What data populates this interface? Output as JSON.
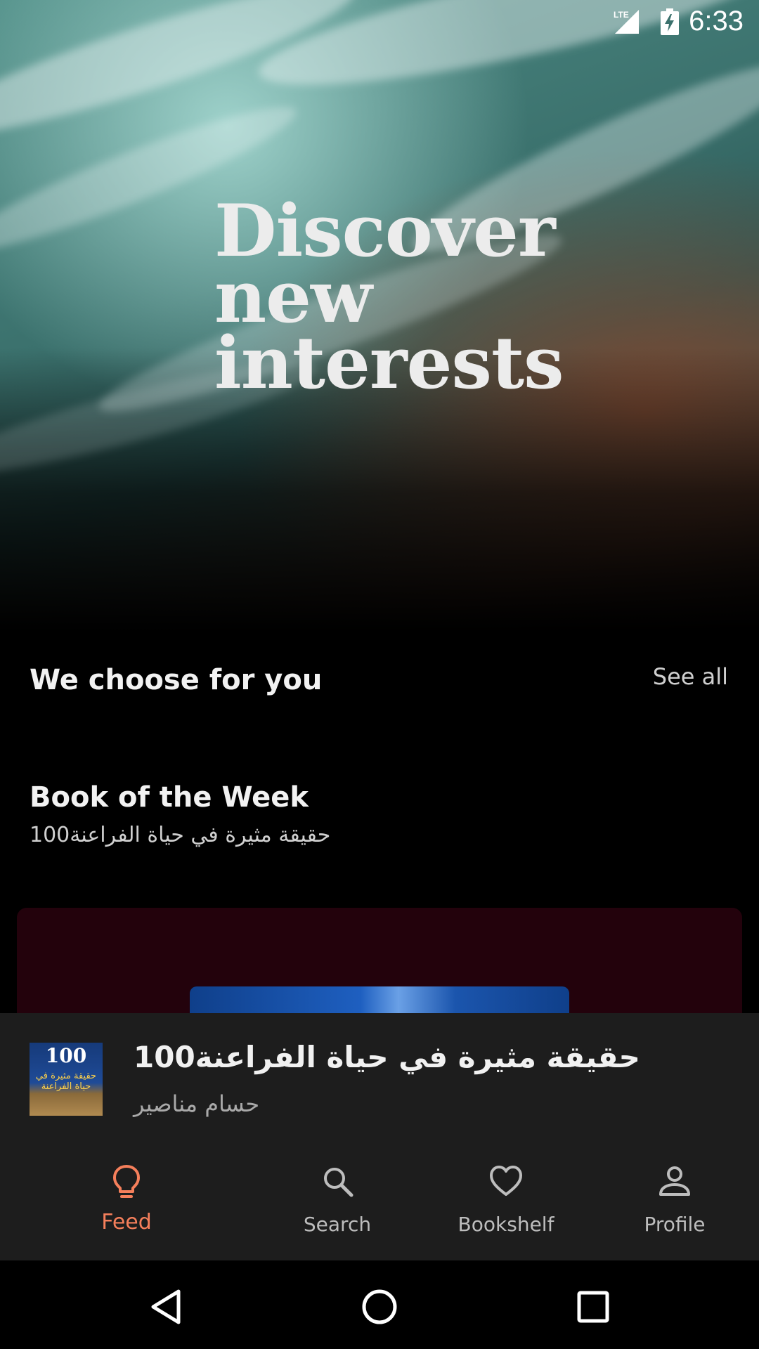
{
  "status_bar": {
    "time": "6:33",
    "network_label": "LTE"
  },
  "hero": {
    "title_lines": [
      "Discover",
      "new",
      "interests"
    ]
  },
  "section": {
    "title": "We choose for you",
    "see_all": "See all"
  },
  "book_of_week": {
    "heading": "Book of the Week",
    "book_title": "100حقيقة مثيرة في حياة الفراعنة"
  },
  "now_playing": {
    "title": "100حقيقة مثيرة في حياة الفراعنة",
    "author": "حسام مناصير",
    "thumb_number": "100",
    "thumb_text": "حقيقة مثيرة في حياة الفراعنة"
  },
  "bottom_nav": {
    "items": [
      {
        "label": "Feed",
        "icon": "lightbulb-icon",
        "active": true
      },
      {
        "label": "Search",
        "icon": "search-icon",
        "active": false
      },
      {
        "label": "Bookshelf",
        "icon": "heart-icon",
        "active": false
      },
      {
        "label": "Profile",
        "icon": "person-icon",
        "active": false
      }
    ]
  },
  "colors": {
    "accent": "#f57f5b",
    "surface": "#1d1d1d",
    "card": "#23020c",
    "background": "#000000"
  }
}
